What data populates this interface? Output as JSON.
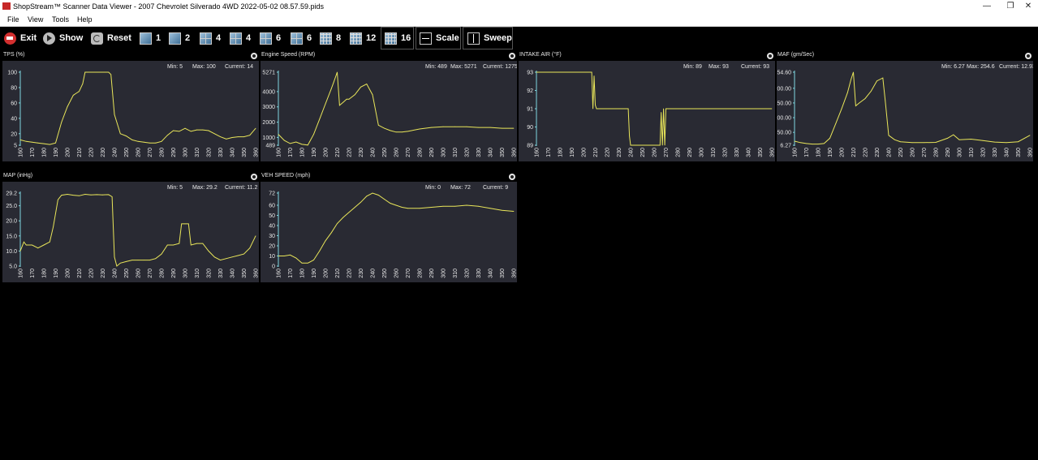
{
  "window": {
    "title": "ShopStream™ Scanner Data Viewer - 2007 Chevrolet Silverado  4WD  2022-05-02 08.57.59.pids",
    "minimize_glyph": "—",
    "restore_glyph": "❐",
    "close_glyph": "✕"
  },
  "menu": [
    "File",
    "View",
    "Tools",
    "Help"
  ],
  "toolbar": {
    "exit": "Exit",
    "show": "Show",
    "reset": "Reset",
    "layouts": [
      "1",
      "2",
      "4",
      "4",
      "6",
      "6",
      "8",
      "12",
      "16"
    ],
    "scale": "Scale",
    "sweep": "Sweep"
  },
  "colors": {
    "trace": "#e9e65a",
    "plot_bg": "#292a33",
    "axis": "#7fd7e0",
    "text": "#e8e8e8"
  },
  "charts": [
    {
      "title": "TPS (%)",
      "stats": {
        "min": "Min: 5",
        "max": "Max: 100",
        "current": "Current: 14"
      },
      "chart_data": {
        "type": "line",
        "x": [
          160,
          165,
          170,
          175,
          180,
          185,
          190,
          195,
          200,
          205,
          207,
          210,
          213,
          215,
          220,
          225,
          230,
          235,
          237,
          240,
          245,
          250,
          255,
          260,
          265,
          270,
          275,
          280,
          285,
          290,
          295,
          300,
          305,
          310,
          315,
          320,
          325,
          330,
          335,
          340,
          345,
          350,
          355,
          360
        ],
        "y": [
          12,
          10,
          9,
          8,
          7,
          6,
          8,
          35,
          55,
          70,
          72,
          75,
          85,
          100,
          100,
          100,
          100,
          100,
          97,
          45,
          20,
          17,
          12,
          10,
          9,
          8,
          8,
          10,
          18,
          24,
          23,
          27,
          23,
          25,
          25,
          24,
          20,
          16,
          13,
          15,
          16,
          16,
          18,
          27
        ],
        "xlim": [
          160,
          360
        ],
        "ylim": [
          5,
          100
        ],
        "yticks": [
          100,
          80,
          60,
          40,
          20,
          5
        ],
        "xticks": [
          160,
          170,
          180,
          190,
          200,
          210,
          220,
          230,
          240,
          250,
          260,
          270,
          280,
          290,
          300,
          310,
          320,
          330,
          340,
          350,
          360
        ]
      }
    },
    {
      "title": "Engine Speed (RPM)",
      "stats": {
        "min": "Min: 489",
        "max": "Max: 5271",
        "current": "Current: 1275"
      },
      "chart_data": {
        "type": "line",
        "x": [
          160,
          165,
          170,
          175,
          180,
          185,
          190,
          195,
          200,
          205,
          207,
          210,
          212,
          215,
          218,
          220,
          225,
          230,
          235,
          240,
          245,
          250,
          255,
          260,
          265,
          270,
          280,
          290,
          300,
          310,
          320,
          330,
          340,
          350,
          360
        ],
        "y": [
          1200,
          800,
          600,
          700,
          550,
          500,
          1200,
          2200,
          3200,
          4200,
          4600,
          5271,
          3100,
          3300,
          3500,
          3500,
          3800,
          4300,
          4500,
          3800,
          1800,
          1600,
          1450,
          1350,
          1350,
          1400,
          1550,
          1650,
          1700,
          1700,
          1700,
          1650,
          1650,
          1600,
          1600
        ],
        "xlim": [
          160,
          360
        ],
        "ylim": [
          489,
          5271
        ],
        "yticks": [
          5271,
          4000,
          3000,
          2000,
          1000,
          489
        ],
        "xticks": [
          160,
          170,
          180,
          190,
          200,
          210,
          220,
          230,
          240,
          250,
          260,
          270,
          280,
          290,
          300,
          310,
          320,
          330,
          340,
          350,
          360
        ]
      }
    },
    {
      "title": "INTAKE AIR (°F)",
      "stats": {
        "min": "Min: 89",
        "max": "Max: 93",
        "current": "Current: 93"
      },
      "chart_data": {
        "type": "line",
        "x": [
          160,
          207,
          208,
          209,
          210,
          211,
          212,
          238,
          239,
          240,
          265,
          266,
          267,
          268,
          269,
          270,
          360
        ],
        "y": [
          93,
          93,
          91,
          92.8,
          91.2,
          91,
          91,
          91,
          89.5,
          89,
          89,
          90.8,
          89,
          91,
          89,
          91,
          91
        ],
        "xlim": [
          160,
          360
        ],
        "ylim": [
          89,
          93
        ],
        "yticks": [
          93,
          92,
          91,
          90,
          89
        ],
        "xticks": [
          160,
          170,
          180,
          190,
          200,
          210,
          220,
          230,
          240,
          250,
          260,
          270,
          280,
          290,
          300,
          310,
          320,
          330,
          340,
          350,
          360
        ]
      }
    },
    {
      "title": "MAF (gm/Sec)",
      "stats": {
        "min": "Min: 6.27",
        "max": "Max: 254.6",
        "current": "Current: 12.93"
      },
      "chart_data": {
        "type": "line",
        "x": [
          160,
          165,
          170,
          175,
          180,
          185,
          190,
          195,
          200,
          205,
          208,
          210,
          212,
          215,
          220,
          225,
          230,
          235,
          237,
          240,
          245,
          250,
          260,
          270,
          280,
          290,
          295,
          300,
          310,
          320,
          330,
          340,
          350,
          360
        ],
        "y": [
          20,
          15,
          12,
          10,
          10,
          12,
          30,
          80,
          130,
          185,
          230,
          254.6,
          140,
          150,
          165,
          190,
          225,
          235,
          160,
          40,
          25,
          18,
          15,
          15,
          16,
          30,
          42,
          25,
          27,
          22,
          17,
          15,
          18,
          40
        ],
        "xlim": [
          160,
          360
        ],
        "ylim": [
          6.27,
          254.6
        ],
        "yticks": [
          254.6,
          200,
          150,
          100,
          50,
          6.27
        ],
        "ytick_labels": [
          "254.60",
          "200.00",
          "150.00",
          "100.00",
          "50.00",
          "6.27"
        ],
        "xticks": [
          160,
          170,
          180,
          190,
          200,
          210,
          220,
          230,
          240,
          250,
          260,
          270,
          280,
          290,
          300,
          310,
          320,
          330,
          340,
          350,
          360
        ]
      }
    },
    {
      "title": "MAP (inHg)",
      "stats": {
        "min": "Min: 5",
        "max": "Max: 29.2",
        "current": "Current: 11.2"
      },
      "chart_data": {
        "type": "line",
        "x": [
          160,
          163,
          165,
          170,
          175,
          180,
          185,
          188,
          192,
          195,
          200,
          205,
          210,
          215,
          220,
          225,
          230,
          235,
          238,
          240,
          242,
          245,
          250,
          255,
          260,
          265,
          270,
          275,
          280,
          285,
          290,
          295,
          297,
          300,
          303,
          305,
          310,
          315,
          320,
          325,
          330,
          335,
          340,
          345,
          350,
          355,
          360
        ],
        "y": [
          10,
          13,
          12,
          12,
          11,
          12,
          13,
          18,
          27,
          28.5,
          28.8,
          28.5,
          28.3,
          28.8,
          28.6,
          28.7,
          28.6,
          28.7,
          28,
          8,
          5,
          6,
          6.5,
          7,
          7,
          7,
          7,
          7.5,
          9,
          12,
          12,
          12.5,
          19,
          19,
          19,
          12,
          12.5,
          12.5,
          10,
          8,
          7,
          7.5,
          8,
          8.5,
          9,
          11,
          15
        ],
        "xlim": [
          160,
          360
        ],
        "ylim": [
          5,
          29.2
        ],
        "yticks": [
          29.2,
          25,
          20,
          15,
          10,
          5
        ],
        "ytick_labels": [
          "29.2",
          "25.0",
          "20.0",
          "15.0",
          "10.0",
          "5.0"
        ],
        "xticks": [
          160,
          170,
          180,
          190,
          200,
          210,
          220,
          230,
          240,
          250,
          260,
          270,
          280,
          290,
          300,
          310,
          320,
          330,
          340,
          350,
          360
        ]
      }
    },
    {
      "title": "VEH SPEED (mph)",
      "stats": {
        "min": "Min: 0",
        "max": "Max: 72",
        "current": "Current: 9"
      },
      "chart_data": {
        "type": "line",
        "x": [
          160,
          165,
          170,
          175,
          180,
          185,
          190,
          195,
          200,
          205,
          210,
          215,
          220,
          225,
          230,
          235,
          240,
          245,
          250,
          255,
          260,
          265,
          270,
          280,
          290,
          300,
          310,
          320,
          330,
          340,
          350,
          360
        ],
        "y": [
          10,
          10,
          11,
          8,
          3,
          3,
          6,
          15,
          25,
          33,
          42,
          48,
          53,
          58,
          63,
          69,
          72,
          70,
          66,
          62,
          60,
          58,
          57,
          57,
          58,
          59,
          59,
          60,
          59,
          57,
          55,
          54
        ],
        "xlim": [
          160,
          360
        ],
        "ylim": [
          0,
          72
        ],
        "yticks": [
          72,
          60,
          50,
          40,
          30,
          20,
          10,
          0
        ],
        "xticks": [
          160,
          170,
          180,
          190,
          200,
          210,
          220,
          230,
          240,
          250,
          260,
          270,
          280,
          290,
          300,
          310,
          320,
          330,
          340,
          350,
          360
        ]
      }
    }
  ]
}
